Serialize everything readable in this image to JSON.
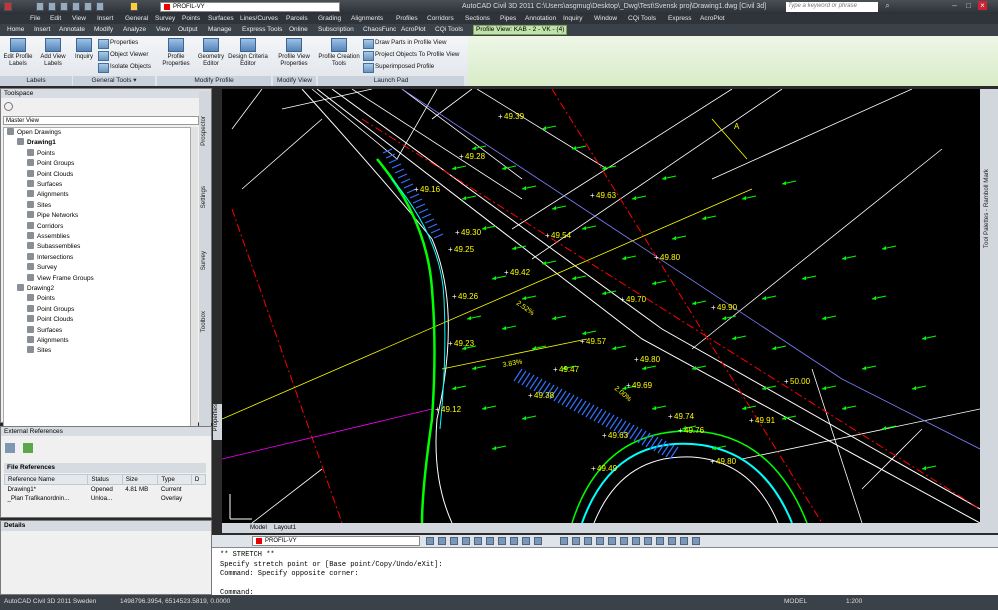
{
  "title_bar": {
    "layer_name": "PROFIL-VY",
    "title": "AutoCAD Civil 3D 2011   C:\\Users\\asgmug\\Desktop\\_Dwg\\Test\\Svensk proj\\Drawing1.dwg [Civil 3d]",
    "search_placeholder": "Type a keyword or phrase"
  },
  "menus": [
    "File",
    "Edit",
    "View",
    "Insert",
    "General",
    "Survey",
    "Points",
    "Surfaces",
    "Lines/Curves",
    "Parcels",
    "Grading",
    "Alignments",
    "Profiles",
    "Corridors",
    "Sections",
    "Pipes",
    "Annotation",
    "Inquiry",
    "Window",
    "CQi Tools",
    "Express",
    "AcroPlot"
  ],
  "ribbon_tabs": [
    "Home",
    "Insert",
    "Annotate",
    "Modify",
    "Analyze",
    "View",
    "Output",
    "Manage",
    "Express Tools",
    "Online",
    "Subscription",
    "ChaosFunc",
    "AcroPlot",
    "CQi Tools",
    "Profile View: KAB - 2 - VK - (4)"
  ],
  "ribbon": {
    "edit_profile_labels": "Edit Profile Labels",
    "add_view_labels": "Add View Labels",
    "labels_panel": "Labels",
    "inquiry": "Inquiry",
    "properties": "Properties",
    "object_viewer": "Object Viewer",
    "isolate_objects": "Isolate Objects",
    "general_tools_panel": "General Tools ▾",
    "profile_properties": "Profile Properties",
    "geometry_editor": "Geometry Editor",
    "design_criteria_editor": "Design Criteria Editor",
    "modify_profile_panel": "Modify Profile",
    "profile_view_properties": "Profile View Properties",
    "modify_view_panel": "Modify View",
    "profile_creation_tools": "Profile Creation Tools",
    "draw_parts_in_profile": "Draw Parts in Profile View",
    "project_objects": "Project Objects To Profile View",
    "superimposed_profile": "Superimposed Profile",
    "launch_pad_panel": "Launch Pad"
  },
  "toolspace": {
    "title": "Toolspace",
    "view": "Master View",
    "tree": [
      {
        "label": "Open Drawings",
        "indent": 0
      },
      {
        "label": "Drawing1",
        "indent": 1,
        "bold": true
      },
      {
        "label": "Points",
        "indent": 2
      },
      {
        "label": "Point Groups",
        "indent": 2
      },
      {
        "label": "Point Clouds",
        "indent": 2
      },
      {
        "label": "Surfaces",
        "indent": 2
      },
      {
        "label": "Alignments",
        "indent": 2
      },
      {
        "label": "Sites",
        "indent": 2
      },
      {
        "label": "Pipe Networks",
        "indent": 2
      },
      {
        "label": "Corridors",
        "indent": 2
      },
      {
        "label": "Assemblies",
        "indent": 2
      },
      {
        "label": "Subassemblies",
        "indent": 2
      },
      {
        "label": "Intersections",
        "indent": 2
      },
      {
        "label": "Survey",
        "indent": 2
      },
      {
        "label": "View Frame Groups",
        "indent": 2
      },
      {
        "label": "Drawing2",
        "indent": 1
      },
      {
        "label": "Points",
        "indent": 2
      },
      {
        "label": "Point Groups",
        "indent": 2
      },
      {
        "label": "Point Clouds",
        "indent": 2
      },
      {
        "label": "Surfaces",
        "indent": 2
      },
      {
        "label": "Alignments",
        "indent": 2
      },
      {
        "label": "Sites",
        "indent": 2
      }
    ],
    "side_tabs": [
      "Prospector",
      "Settings",
      "Survey",
      "Toolbox"
    ]
  },
  "xref": {
    "title": "External References",
    "file_refs": "File References",
    "columns": [
      "Reference Name",
      "Status",
      "Size",
      "Type",
      "D"
    ],
    "rows": [
      [
        "Drawing1*",
        "Opened",
        "4.81 MB",
        "Current",
        ""
      ],
      [
        "_Plan Trafikanordnin...",
        "Unloa...",
        "",
        "Overlay",
        ""
      ]
    ],
    "details": "Details",
    "properties_tab": "Properties"
  },
  "drawing": {
    "elevations": [
      "49.39",
      "49.28",
      "49.16",
      "49.63",
      "49.30",
      "49.54",
      "49.25",
      "49.42",
      "49.80",
      "49.26",
      "49.70",
      "49.90",
      "49.23",
      "49.57",
      "49.80",
      "50.00",
      "49.47",
      "49.69",
      "49.38",
      "49.12",
      "49.74",
      "49.91",
      "49.76",
      "49.63",
      "49.80",
      "49.49"
    ],
    "slopes": [
      "2.52%",
      "3.83%",
      "2.00%"
    ],
    "marker": "A",
    "colors": {
      "background": "#000000",
      "elev_text": "#ffff00",
      "arrows": "#00ff00",
      "lines": "#ffffff",
      "alignment": "#ff0000"
    }
  },
  "right_palette": "Tool Palettes - Ramboll Mark",
  "layout_tabs": [
    "Model",
    "Layout1"
  ],
  "bottom_layer": "PROFIL-VY",
  "command_lines": [
    "** STRETCH **",
    "Specify stretch point or [Base point/Copy/Undo/eXit]:",
    "Command: Specify opposite corner:",
    "",
    "Command:"
  ],
  "status": {
    "app": "AutoCAD Civil 3D 2011 Sweden",
    "coords": "1498796.3954, 6514523.5819, 0.0000",
    "model": "MODEL",
    "scale": "1:200"
  }
}
